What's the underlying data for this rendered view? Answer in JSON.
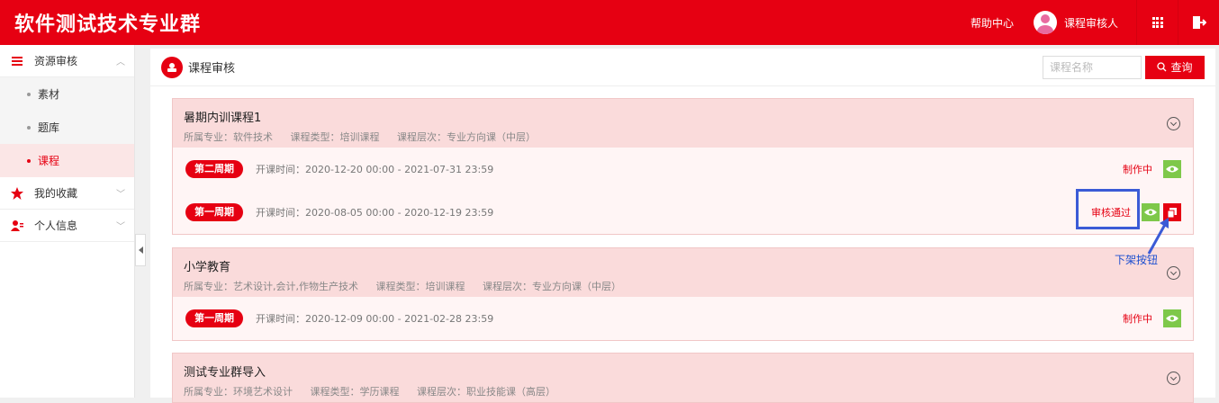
{
  "header": {
    "title": "软件测试技术专业群",
    "help_label": "帮助中心",
    "user_name": "课程审核人"
  },
  "sidebar": {
    "groups": [
      {
        "label": "资源审核",
        "icon": "list-icon",
        "expanded": true,
        "items": [
          {
            "label": "素材"
          },
          {
            "label": "题库"
          },
          {
            "label": "课程",
            "active": true
          }
        ]
      },
      {
        "label": "我的收藏",
        "icon": "star-icon"
      },
      {
        "label": "个人信息",
        "icon": "user-icon"
      }
    ]
  },
  "main": {
    "title": "课程审核",
    "search": {
      "placeholder": "课程名称",
      "button_label": "查询"
    },
    "courses": [
      {
        "title": "暑期内训课程1",
        "meta": [
          "所属专业：软件技术",
          "课程类型：培训课程",
          "课程层次：专业方向课（中层）"
        ],
        "periods": [
          {
            "name": "第二周期",
            "time": "开课时间：2020-12-20 00:00 - 2021-07-31 23:59",
            "status": "制作中"
          },
          {
            "name": "第一周期",
            "time": "开课时间：2020-08-05 00:00 - 2020-12-19 23:59",
            "status": "审核通过"
          }
        ]
      },
      {
        "title": "小学教育",
        "meta": [
          "所属专业：艺术设计,会计,作物生产技术",
          "课程类型：培训课程",
          "课程层次：专业方向课（中层）"
        ],
        "periods": [
          {
            "name": "第一周期",
            "time": "开课时间：2020-12-09 00:00 - 2021-02-28 23:59",
            "status": "制作中"
          }
        ]
      },
      {
        "title": "测试专业群导入",
        "meta": [
          "所属专业：环境艺术设计",
          "课程类型：学历课程",
          "课程层次：职业技能课（高层）"
        ],
        "periods": []
      }
    ]
  },
  "annotation": {
    "label": "下架按钮",
    "color": "#3b5bd6"
  },
  "colors": {
    "brand": "#e60012",
    "view_button": "#7ec84a",
    "course_header_bg": "#fadbdb"
  }
}
